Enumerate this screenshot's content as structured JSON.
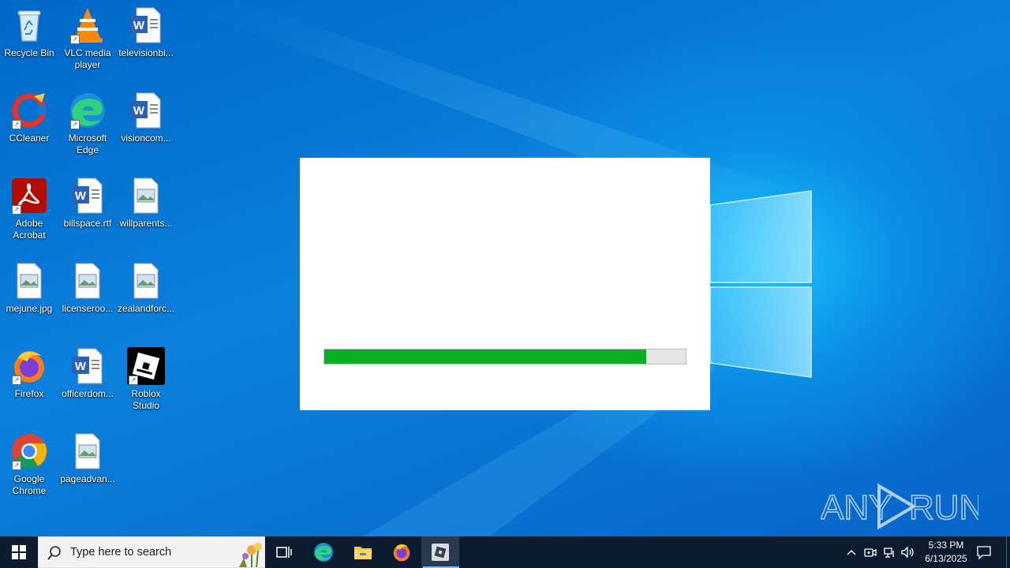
{
  "desktop": {
    "icons": [
      {
        "label": "Recycle Bin",
        "icon": "recycle-bin-icon"
      },
      {
        "label": "VLC media player",
        "icon": "vlc-icon"
      },
      {
        "label": "televisionbi...",
        "icon": "word-document-icon"
      },
      {
        "label": "CCleaner",
        "icon": "ccleaner-icon"
      },
      {
        "label": "Microsoft Edge",
        "icon": "edge-icon"
      },
      {
        "label": "visioncom...",
        "icon": "word-document-icon"
      },
      {
        "label": "Adobe Acrobat",
        "icon": "acrobat-icon"
      },
      {
        "label": "billspace.rtf",
        "icon": "word-document-icon"
      },
      {
        "label": "willparents...",
        "icon": "image-file-icon"
      },
      {
        "label": "mejune.jpg",
        "icon": "image-file-icon"
      },
      {
        "label": "licenseroo...",
        "icon": "image-file-icon"
      },
      {
        "label": "zealandforc...",
        "icon": "image-file-icon"
      },
      {
        "label": "Firefox",
        "icon": "firefox-icon"
      },
      {
        "label": "officerdom...",
        "icon": "word-document-icon"
      },
      {
        "label": "Roblox Studio",
        "icon": "roblox-studio-icon"
      },
      {
        "label": "Google Chrome",
        "icon": "chrome-icon"
      },
      {
        "label": "pageadvan...",
        "icon": "image-file-icon"
      }
    ]
  },
  "dialog": {
    "progress_percent": 89,
    "progress_color": "#06b025"
  },
  "watermark": {
    "text": "ANY RUN"
  },
  "taskbar": {
    "search_placeholder": "Type here to search",
    "pinned": [
      "task-view-icon",
      "edge-icon",
      "file-explorer-icon",
      "firefox-icon",
      "roblox-studio-icon"
    ],
    "clock": {
      "time": "5:33 PM",
      "date": "6/13/2025"
    }
  },
  "colors": {
    "taskbar": "#0c1b2e",
    "wallpaper": "#0a79d6"
  }
}
